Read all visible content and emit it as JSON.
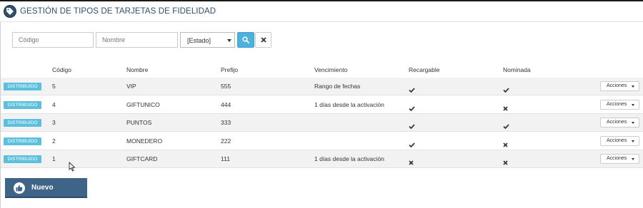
{
  "header": {
    "title": "GESTIÓN DE TIPOS DE TARJETAS DE FIDELIDAD",
    "icon": "tag-icon"
  },
  "filters": {
    "codigo_placeholder": "Código",
    "nombre_placeholder": "Nombre",
    "estado_selected": "[Estado]",
    "search_icon": "search-icon",
    "clear_icon": "close-icon"
  },
  "table": {
    "columns": [
      "Código",
      "Nombre",
      "Prefijo",
      "Vencimiento",
      "Recargable",
      "Nominada"
    ],
    "rows": [
      {
        "estado": "DISTRIBUIDO",
        "codigo": "5",
        "nombre": "VIP",
        "prefijo": "555",
        "vencimiento": "Rango de fechas",
        "recargable": true,
        "nominada": true,
        "acciones": "Acciones"
      },
      {
        "estado": "DISTRIBUIDO",
        "codigo": "4",
        "nombre": "GIFTUNICO",
        "prefijo": "444",
        "vencimiento": "1 días desde la activación",
        "recargable": true,
        "nominada": false,
        "acciones": "Acciones"
      },
      {
        "estado": "DISTRIBUIDO",
        "codigo": "3",
        "nombre": "PUNTOS",
        "prefijo": "333",
        "vencimiento": "",
        "recargable": true,
        "nominada": true,
        "acciones": "Acciones"
      },
      {
        "estado": "DISTRIBUIDO",
        "codigo": "2",
        "nombre": "MONEDERO",
        "prefijo": "222",
        "vencimiento": "",
        "recargable": true,
        "nominada": false,
        "acciones": "Acciones"
      },
      {
        "estado": "DISTRIBUIDO",
        "codigo": "1",
        "nombre": "GIFTCARD",
        "prefijo": "111",
        "vencimiento": "1 días desde la activación",
        "recargable": false,
        "nominada": false,
        "acciones": "Acciones"
      }
    ]
  },
  "footer": {
    "nuevo_label": "Nuevo",
    "nuevo_icon": "thumbs-up-icon"
  },
  "colors": {
    "header_title": "#2f4f6f",
    "badge": "#5bc0de",
    "search_button": "#4cb2dd",
    "nuevo_button": "#3e6487"
  }
}
